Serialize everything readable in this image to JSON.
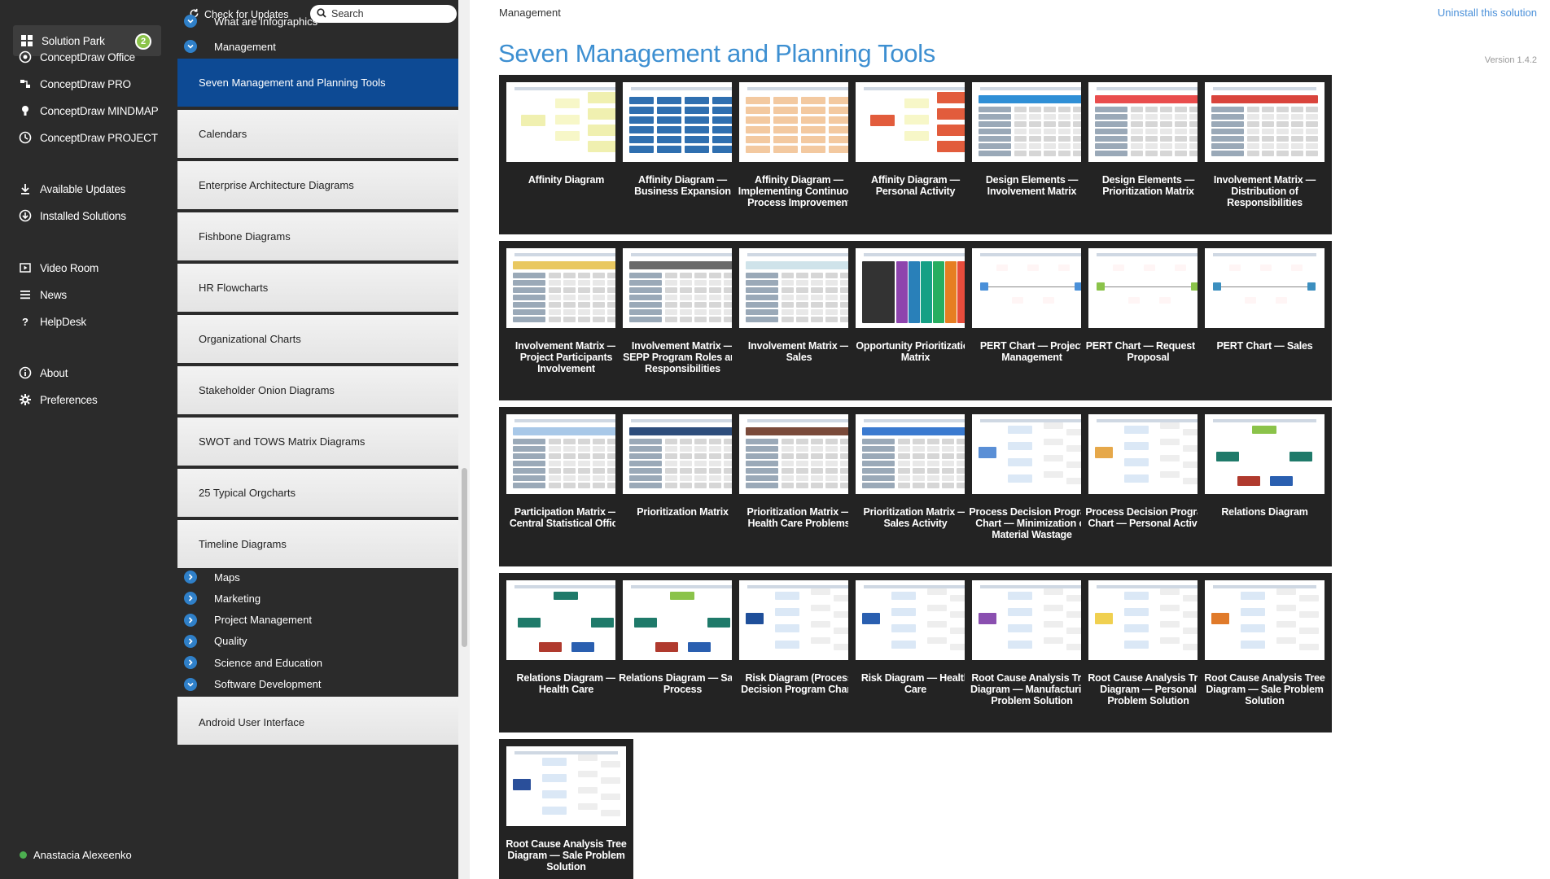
{
  "nav": {
    "items": [
      {
        "label": "Solution Park",
        "icon": "solution-park-icon",
        "badge": "2",
        "active": true
      },
      {
        "label": "ConceptDraw Office",
        "icon": "office-icon"
      },
      {
        "label": "ConceptDraw PRO",
        "icon": "pro-icon"
      },
      {
        "label": "ConceptDraw MINDMAP",
        "icon": "mindmap-icon"
      },
      {
        "label": "ConceptDraw PROJECT",
        "icon": "project-icon"
      },
      {
        "label": "Available Updates",
        "icon": "updates-icon"
      },
      {
        "label": "Installed Solutions",
        "icon": "installed-icon"
      },
      {
        "label": "Video Room",
        "icon": "video-icon"
      },
      {
        "label": "News",
        "icon": "news-icon"
      },
      {
        "label": "HelpDesk",
        "icon": "help-icon"
      },
      {
        "label": "About",
        "icon": "about-icon"
      },
      {
        "label": "Preferences",
        "icon": "gear-icon"
      }
    ],
    "user": "Anastacia Alexeenko"
  },
  "toolbar": {
    "check_updates": "Check for Updates",
    "search_placeholder": "Search"
  },
  "categories": {
    "top": [
      {
        "label": "What are Infographics"
      },
      {
        "label": "Management"
      }
    ],
    "subitems": [
      {
        "label": "Seven Management and Planning Tools",
        "selected": true
      },
      {
        "label": "Calendars"
      },
      {
        "label": "Enterprise Architecture Diagrams"
      },
      {
        "label": "Fishbone Diagrams"
      },
      {
        "label": "HR Flowcharts"
      },
      {
        "label": "Organizational Charts"
      },
      {
        "label": "Stakeholder Onion Diagrams"
      },
      {
        "label": "SWOT and TOWS Matrix Diagrams"
      },
      {
        "label": "25 Typical Orgcharts"
      },
      {
        "label": "Timeline Diagrams"
      }
    ],
    "bottom": [
      {
        "label": "Maps"
      },
      {
        "label": "Marketing"
      },
      {
        "label": "Project Management"
      },
      {
        "label": "Quality"
      },
      {
        "label": "Science and Education"
      },
      {
        "label": "Software Development"
      }
    ],
    "last_item": "Android User Interface"
  },
  "main": {
    "breadcrumb": "Management",
    "uninstall": "Uninstall this solution",
    "title": "Seven Management and Planning Tools",
    "version": "Version 1.4.2",
    "tiles": [
      {
        "label": "Affinity Diagram",
        "thumb": "affinity",
        "accent": "#f0f0b0"
      },
      {
        "label": "Affinity Diagram — Business Expansion",
        "thumb": "columns",
        "accent": "#2f6fb0"
      },
      {
        "label": "Affinity Diagram — Implementing Continuous Process Improvement",
        "thumb": "columns-light",
        "accent": "#f3c9a0"
      },
      {
        "label": "Affinity Diagram — Personal Activity",
        "thumb": "affinity-yellow",
        "accent": "#e25c3c"
      },
      {
        "label": "Design Elements — Involvement Matrix",
        "thumb": "tables",
        "accent": "#2f8fd6"
      },
      {
        "label": "Design Elements — Prioritization Matrix",
        "thumb": "color-table",
        "accent": "#e94d4d"
      },
      {
        "label": "Involvement Matrix — Distribution of Responsibilities",
        "thumb": "red-matrix",
        "accent": "#d9443c"
      },
      {
        "label": "Involvement Matrix — Project Participants Involvement",
        "thumb": "symbol-matrix",
        "accent": "#e9c860"
      },
      {
        "label": "Involvement Matrix — SEPP Program Roles and Responsibilities",
        "thumb": "gray-grid",
        "accent": "#6a6a6a"
      },
      {
        "label": "Involvement Matrix — Sales",
        "thumb": "sales-matrix",
        "accent": "#cfe3ea"
      },
      {
        "label": "Opportunity Prioritization Matrix",
        "thumb": "rainbow",
        "accent": "#222222"
      },
      {
        "label": "PERT Chart — Project Management",
        "thumb": "pert",
        "accent": "#4a90d9"
      },
      {
        "label": "PERT Chart — Request for Proposal",
        "thumb": "pert-green",
        "accent": "#8bc34a"
      },
      {
        "label": "PERT Chart — Sales",
        "thumb": "pert-simple",
        "accent": "#3c8fbf"
      },
      {
        "label": "Participation Matrix — Central Statistical Office",
        "thumb": "participation",
        "accent": "#a8c8e8"
      },
      {
        "label": "Prioritization Matrix",
        "thumb": "prio-blue",
        "accent": "#2d4d7c"
      },
      {
        "label": "Prioritization Matrix — Health Care Problems",
        "thumb": "prio-brown",
        "accent": "#7a4a3a"
      },
      {
        "label": "Prioritization Matrix — Sales Activity",
        "thumb": "prio-sales",
        "accent": "#3a7ad0"
      },
      {
        "label": "Process Decision Program Chart — Minimization of Material Wastage",
        "thumb": "pdpc",
        "accent": "#5a8fd6"
      },
      {
        "label": "Process Decision Program Chart — Personal Activity",
        "thumb": "pdpc-color",
        "accent": "#e6a84a"
      },
      {
        "label": "Relations Diagram",
        "thumb": "relations",
        "accent": "#8bc34a"
      },
      {
        "label": "Relations Diagram — Health Care",
        "thumb": "relations-circle",
        "accent": "#1f7a6a"
      },
      {
        "label": "Relations Diagram — Sales Process",
        "thumb": "relations-sales",
        "accent": "#8bc34a"
      },
      {
        "label": "Risk Diagram (Process Decision Program Chart)",
        "thumb": "risk",
        "accent": "#1f4f9a"
      },
      {
        "label": "Risk Diagram — Health Care",
        "thumb": "risk-tree",
        "accent": "#2a5fb0"
      },
      {
        "label": "Root Cause Analysis Tree Diagram — Manufacturing Problem Solution",
        "thumb": "rca-purple",
        "accent": "#8a4fb0"
      },
      {
        "label": "Root Cause Analysis Tree Diagram — Personal Problem Solution",
        "thumb": "rca-yellow",
        "accent": "#f0d050"
      },
      {
        "label": "Root Cause Analysis Tree Diagram — Sale Problem Solution",
        "thumb": "rca-orange",
        "accent": "#e07a2a"
      },
      {
        "label": "Root Cause Analysis Tree Diagram — Sale Problem Solution",
        "thumb": "rca-blue",
        "accent": "#2a4f9a"
      }
    ]
  }
}
